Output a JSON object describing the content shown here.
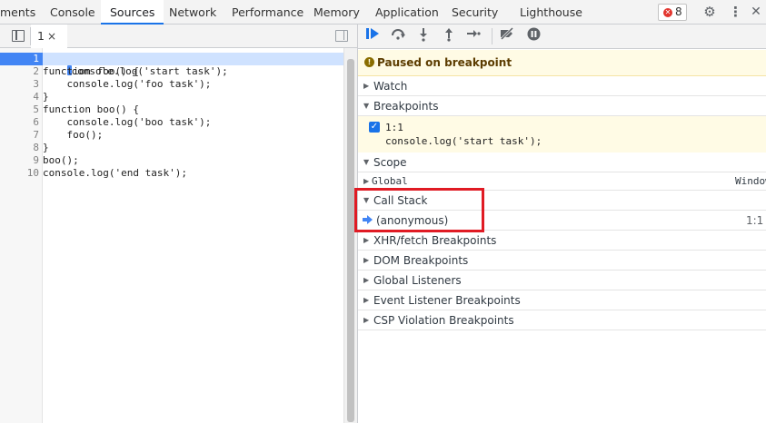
{
  "panel_tabs": [
    "ments",
    "Console",
    "Sources",
    "Network",
    "Performance",
    "Memory",
    "Application",
    "Security",
    "Lighthouse"
  ],
  "active_tab": "Sources",
  "error_count": "8",
  "editor": {
    "file_tab_label": "1",
    "close_glyph": "×",
    "lines": [
      {
        "n": "1",
        "code": "console.log('start task');"
      },
      {
        "n": "2",
        "code": "function foo() {"
      },
      {
        "n": "3",
        "code": "    console.log('foo task');"
      },
      {
        "n": "4",
        "code": "}"
      },
      {
        "n": "5",
        "code": "function boo() {"
      },
      {
        "n": "6",
        "code": "    console.log('boo task');"
      },
      {
        "n": "7",
        "code": "    foo();"
      },
      {
        "n": "8",
        "code": "}"
      },
      {
        "n": "9",
        "code": "boo();"
      },
      {
        "n": "10",
        "code": "console.log('end task');"
      }
    ],
    "breakpoint_line": "1"
  },
  "debugger": {
    "paused_message": "Paused on breakpoint",
    "sections": {
      "watch": "Watch",
      "breakpoints": "Breakpoints",
      "scope": "Scope",
      "call_stack": "Call Stack",
      "xhr": "XHR/fetch Breakpoints",
      "dom": "DOM Breakpoints",
      "global_listeners": "Global Listeners",
      "event_listener": "Event Listener Breakpoints",
      "csp": "CSP Violation Breakpoints"
    },
    "breakpoint_item": {
      "location": "1:1",
      "code": "console.log('start task');",
      "checked": true
    },
    "scope_global": {
      "name": "Global",
      "value": "Window"
    },
    "call_frame": {
      "name": "(anonymous)",
      "location": "1:1"
    }
  },
  "colors": {
    "accent": "#1a73e8",
    "paused_bg": "#fffbe5",
    "highlight_box": "#e01b24",
    "breakpoint_marker": "#4285f4"
  }
}
